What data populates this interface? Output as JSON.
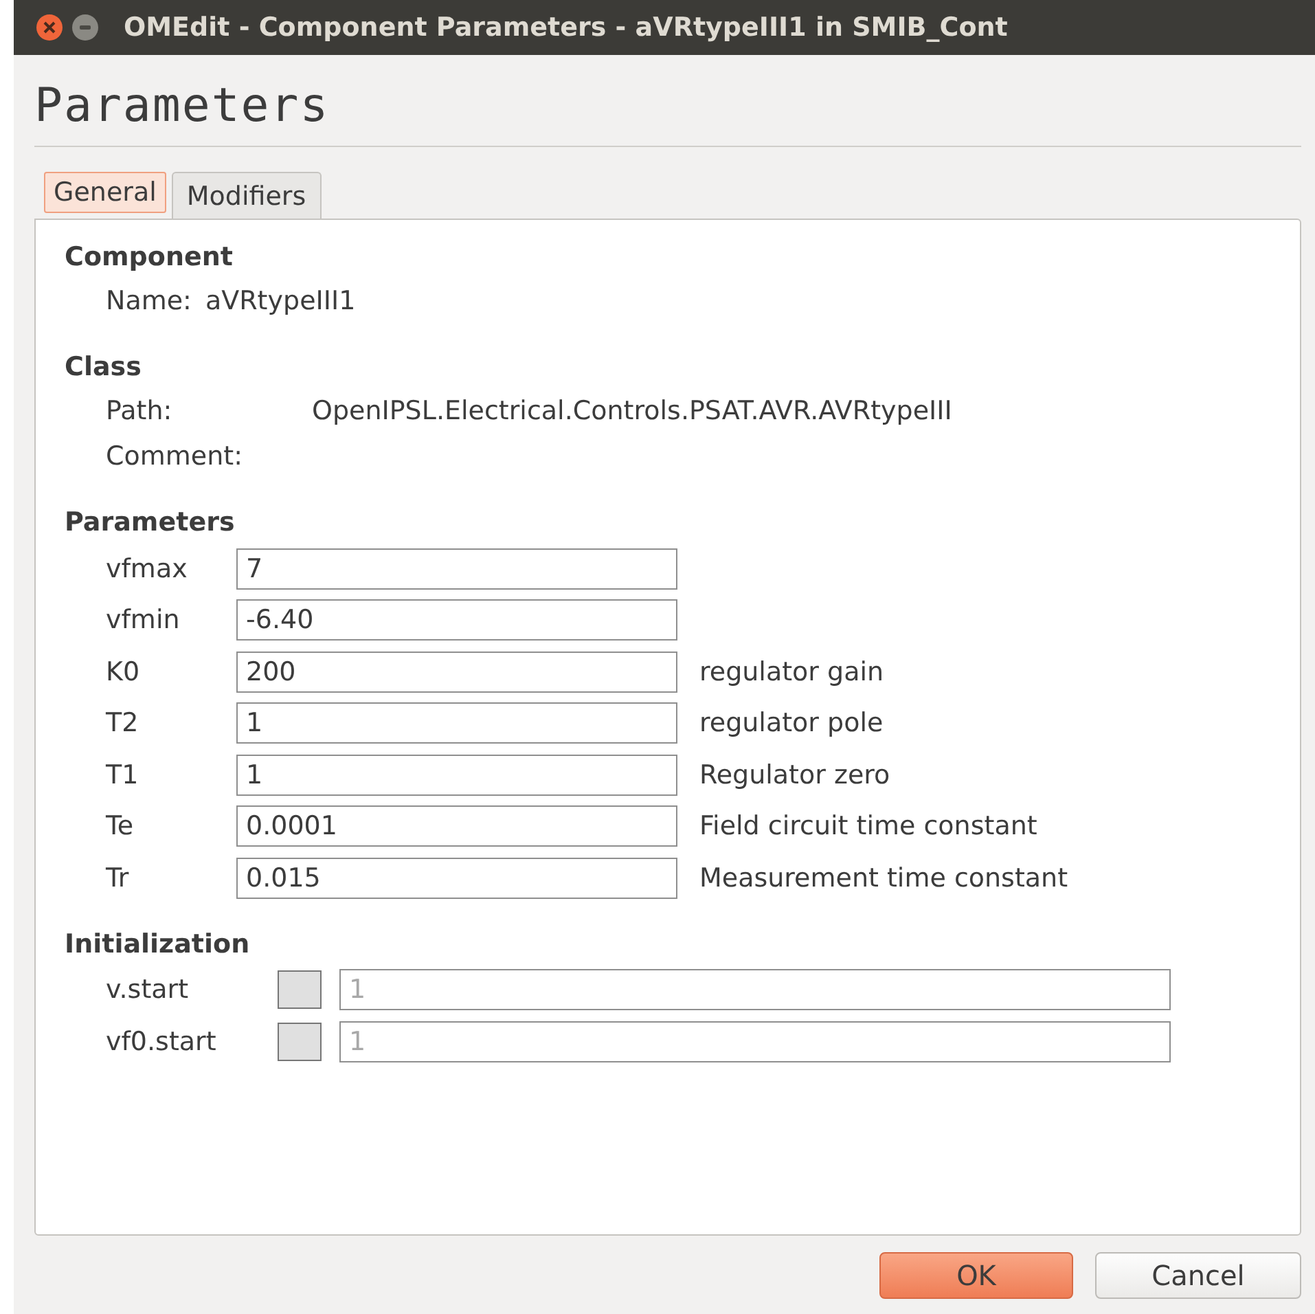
{
  "window": {
    "title": "OMEdit - Component Parameters - aVRtypeIII1 in SMIB_Cont"
  },
  "heading": "Parameters",
  "tabs": [
    {
      "label": "General",
      "selected": true
    },
    {
      "label": "Modifiers",
      "selected": false
    }
  ],
  "component": {
    "title": "Component",
    "name_label": "Name:",
    "name": "aVRtypeIII1"
  },
  "class": {
    "title": "Class",
    "path_label": "Path:",
    "path": "OpenIPSL.Electrical.Controls.PSAT.AVR.AVRtypeIII",
    "comment_label": "Comment:"
  },
  "parameters": {
    "title": "Parameters",
    "rows": [
      {
        "name": "vfmax",
        "value": "7"
      },
      {
        "name": "vfmin",
        "value": "-6.40"
      },
      {
        "name": "K0",
        "value": "200",
        "comment": "regulator gain"
      },
      {
        "name": "T2",
        "value": "1",
        "comment": "regulator pole"
      },
      {
        "name": "T1",
        "value": "1",
        "comment": "Regulator zero"
      },
      {
        "name": "Te",
        "value": "0.0001",
        "comment": "Field circuit time constant"
      },
      {
        "name": "Tr",
        "value": "0.015",
        "comment": "Measurement time constant"
      }
    ]
  },
  "initialization": {
    "title": "Initialization",
    "rows": [
      {
        "name": "v.start",
        "checked": false,
        "placeholder": "1"
      },
      {
        "name": "vf0.start",
        "checked": false,
        "placeholder": "1"
      }
    ]
  },
  "buttons": [
    {
      "label": "OK",
      "kind": "primary"
    },
    {
      "label": "Cancel",
      "kind": "secondary"
    }
  ]
}
